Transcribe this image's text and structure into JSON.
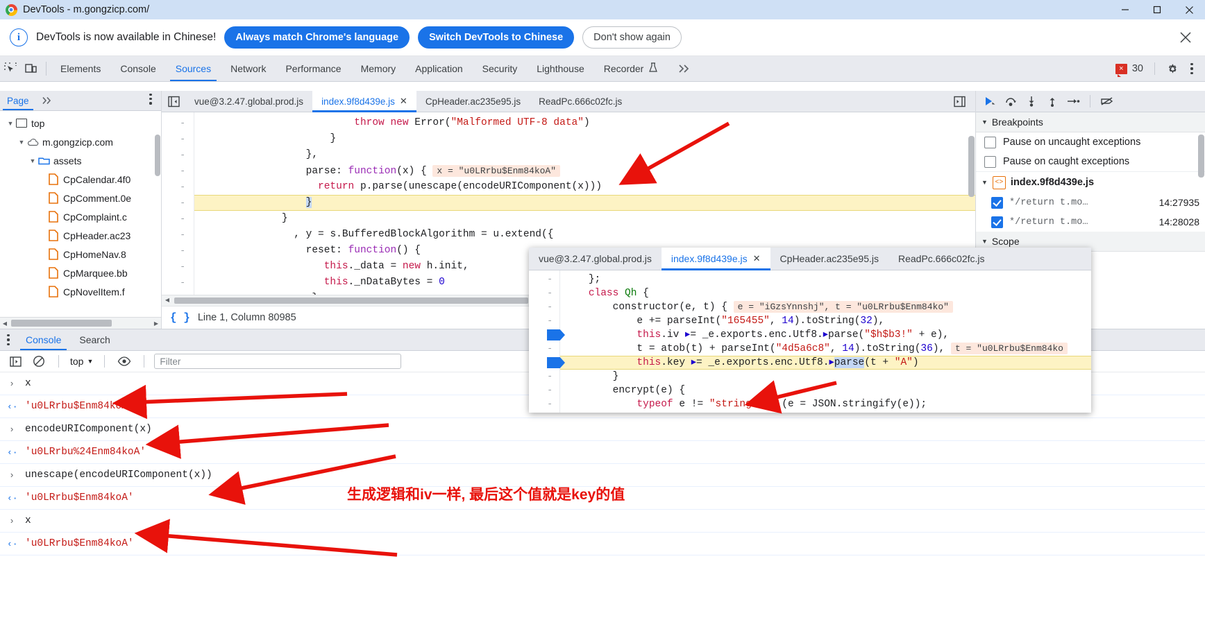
{
  "window": {
    "title": "DevTools - m.gongzicp.com/",
    "logo_icon": "chrome-logo",
    "minimize_icon": "minimize-icon",
    "maximize_icon": "maximize-icon",
    "close_icon": "close-icon"
  },
  "locale_bar": {
    "info_icon": "info-circle-icon",
    "message": "DevTools is now available in Chinese!",
    "always_match_label": "Always match Chrome's language",
    "switch_label": "Switch DevTools to Chinese",
    "dismiss_label": "Don't show again",
    "close_icon": "close-icon",
    "accent_color": "#1a73e8"
  },
  "devtools_tabs": {
    "inspect_icon": "inspect-element-icon",
    "device_icon": "device-toolbar-icon",
    "items": [
      {
        "label": "Elements",
        "active": false
      },
      {
        "label": "Console",
        "active": false
      },
      {
        "label": "Sources",
        "active": true
      },
      {
        "label": "Network",
        "active": false
      },
      {
        "label": "Performance",
        "active": false
      },
      {
        "label": "Memory",
        "active": false
      },
      {
        "label": "Application",
        "active": false
      },
      {
        "label": "Security",
        "active": false
      },
      {
        "label": "Lighthouse",
        "active": false
      },
      {
        "label": "Recorder",
        "active": false
      }
    ],
    "recorder_icon": "flask-icon",
    "overflow_icon": "chevron-double-right-icon",
    "error_badge": {
      "icon": "error-badge-icon",
      "count": "30",
      "color": "#d93025"
    },
    "settings_icon": "gear-icon",
    "menu_icon": "kebab-menu-icon"
  },
  "navigator": {
    "tab_label": "Page",
    "more_icon": "chevron-double-right-icon",
    "menu_icon": "kebab-menu-icon",
    "tree": [
      {
        "label": "top",
        "icon": "frame-icon",
        "depth": 0,
        "caret": "expanded"
      },
      {
        "label": "m.gongzicp.com",
        "icon": "cloud-icon",
        "depth": 1,
        "caret": "expanded"
      },
      {
        "label": "assets",
        "icon": "folder-icon",
        "depth": 2,
        "caret": "expanded"
      },
      {
        "label": "CpCalendar.4f0",
        "icon": "file-icon",
        "depth": 3,
        "caret": "none"
      },
      {
        "label": "CpComment.0e",
        "icon": "file-icon",
        "depth": 3,
        "caret": "none"
      },
      {
        "label": "CpComplaint.c",
        "icon": "file-icon",
        "depth": 3,
        "caret": "none"
      },
      {
        "label": "CpHeader.ac23",
        "icon": "file-icon",
        "depth": 3,
        "caret": "none"
      },
      {
        "label": "CpHomeNav.8",
        "icon": "file-icon",
        "depth": 3,
        "caret": "none"
      },
      {
        "label": "CpMarquee.bb",
        "icon": "file-icon",
        "depth": 3,
        "caret": "none"
      },
      {
        "label": "CpNovelItem.f",
        "icon": "file-icon",
        "depth": 3,
        "caret": "none"
      }
    ],
    "hscroll_left_icon": "triangle-left-icon",
    "hscroll_right_icon": "triangle-right-icon"
  },
  "editor": {
    "panel_toggle_icon": "show-navigator-icon",
    "tabs": [
      {
        "label": "vue@3.2.47.global.prod.js",
        "active": false,
        "closable": false
      },
      {
        "label": "index.9f8d439e.js",
        "active": true,
        "closable": true
      },
      {
        "label": "CpHeader.ac235e95.js",
        "active": false,
        "closable": false
      },
      {
        "label": "ReadPc.666c02fc.js",
        "active": false,
        "closable": false
      }
    ],
    "close_tab_icon": "close-icon",
    "right_panel_icon": "show-debugger-icon",
    "gutter_marks": [
      "-",
      "-",
      "-",
      "-",
      "-",
      "-",
      "-",
      "-",
      "-",
      "-",
      "-",
      "-"
    ],
    "status": {
      "format_icon": "pretty-print-icon",
      "text": "Line 1, Column 80985"
    }
  },
  "code_main": {
    "lines": [
      {
        "indent": 26,
        "highlight": false,
        "tokens": [
          {
            "t": "throw ",
            "c": "kw2"
          },
          {
            "t": "new ",
            "c": "kw2"
          },
          {
            "t": "Error",
            "c": "plain"
          },
          {
            "t": "(",
            "c": "plain"
          },
          {
            "t": "\"Malformed UTF-8 data\"",
            "c": "str"
          },
          {
            "t": ")",
            "c": "plain"
          }
        ]
      },
      {
        "indent": 22,
        "highlight": false,
        "tokens": [
          {
            "t": "}",
            "c": "plain"
          }
        ]
      },
      {
        "indent": 18,
        "highlight": false,
        "tokens": [
          {
            "t": "},",
            "c": "plain"
          }
        ]
      },
      {
        "indent": 18,
        "highlight": false,
        "tokens": [
          {
            "t": "parse",
            "c": "plain"
          },
          {
            "t": ": ",
            "c": "plain"
          },
          {
            "t": "function",
            "c": "kw"
          },
          {
            "t": "(x) { ",
            "c": "plain"
          }
        ],
        "inline_value": "x = \"u0LRrbu$Enm84koA\""
      },
      {
        "indent": 20,
        "highlight": false,
        "tokens": [
          {
            "t": "return ",
            "c": "kw2"
          },
          {
            "t": "p.",
            "c": "plain"
          },
          {
            "t": "parse",
            "c": "plain"
          },
          {
            "t": "(unescape(encodeURIComponent(x)))",
            "c": "plain"
          }
        ]
      },
      {
        "indent": 18,
        "highlight": true,
        "tokens": [
          {
            "t": "}",
            "c": "cursor"
          }
        ]
      },
      {
        "indent": 14,
        "highlight": false,
        "tokens": [
          {
            "t": "}",
            "c": "plain"
          }
        ]
      },
      {
        "indent": 16,
        "highlight": false,
        "tokens": [
          {
            "t": ", y = s.BufferedBlockAlgorithm = u.extend({",
            "c": "plain"
          }
        ]
      },
      {
        "indent": 18,
        "highlight": false,
        "tokens": [
          {
            "t": "reset",
            "c": "plain"
          },
          {
            "t": ": ",
            "c": "plain"
          },
          {
            "t": "function",
            "c": "kw"
          },
          {
            "t": "() {",
            "c": "plain"
          }
        ]
      },
      {
        "indent": 21,
        "highlight": false,
        "tokens": [
          {
            "t": "this",
            "c": "kw2"
          },
          {
            "t": "._data = ",
            "c": "plain"
          },
          {
            "t": "new ",
            "c": "kw2"
          },
          {
            "t": "h.init,",
            "c": "plain"
          }
        ]
      },
      {
        "indent": 21,
        "highlight": false,
        "tokens": [
          {
            "t": "this",
            "c": "kw2"
          },
          {
            "t": "._nDataBytes = ",
            "c": "plain"
          },
          {
            "t": "0",
            "c": "num"
          }
        ]
      },
      {
        "indent": 19,
        "highlight": false,
        "tokens": [
          {
            "t": "},",
            "c": "plain"
          }
        ]
      }
    ]
  },
  "debugger": {
    "toolbar_icons": [
      "resume-icon",
      "step-over-icon",
      "step-into-icon",
      "step-out-icon",
      "step-icon",
      "deactivate-breakpoints-icon"
    ],
    "breakpoints": {
      "section_label": "Breakpoints",
      "caret": "expanded",
      "options": [
        {
          "label": "Pause on uncaught exceptions",
          "checked": false
        },
        {
          "label": "Pause on caught exceptions",
          "checked": false
        }
      ],
      "file": {
        "label": "index.9f8d439e.js",
        "icon": "js-file-icon",
        "caret": "expanded"
      },
      "rows": [
        {
          "label": "*/return t.mo…",
          "location": "14:27935",
          "checked": true
        },
        {
          "label": "*/return t.mo…",
          "location": "14:28028",
          "checked": true
        }
      ]
    },
    "scope": {
      "section_label": "Scope",
      "caret": "expanded"
    }
  },
  "overlay_window": {
    "tabs": [
      {
        "label": "vue@3.2.47.global.prod.js",
        "active": false,
        "closable": false
      },
      {
        "label": "index.9f8d439e.js",
        "active": true,
        "closable": true
      },
      {
        "label": "CpHeader.ac235e95.js",
        "active": false,
        "closable": false
      },
      {
        "label": "ReadPc.666c02fc.js",
        "active": false,
        "closable": false
      }
    ],
    "close_tab_icon": "close-icon",
    "lines": [
      {
        "indent": 4,
        "highlight": false,
        "bp": false,
        "tokens": [
          {
            "t": "};",
            "c": "plain"
          }
        ]
      },
      {
        "indent": 4,
        "highlight": false,
        "bp": false,
        "tokens": [
          {
            "t": "class ",
            "c": "kw2"
          },
          {
            "t": "Qh",
            "c": "tag"
          },
          {
            "t": " {",
            "c": "plain"
          }
        ]
      },
      {
        "indent": 8,
        "highlight": false,
        "bp": false,
        "tokens": [
          {
            "t": "constructor",
            "c": "plain"
          },
          {
            "t": "(e, t) { ",
            "c": "plain"
          }
        ],
        "inline_value": "e = \"iGzsYnnshj\", t = \"u0LRrbu$Enm84ko\""
      },
      {
        "indent": 12,
        "highlight": false,
        "bp": false,
        "tokens": [
          {
            "t": "e += parseInt(",
            "c": "plain"
          },
          {
            "t": "\"165455\"",
            "c": "str"
          },
          {
            "t": ", ",
            "c": "plain"
          },
          {
            "t": "14",
            "c": "num"
          },
          {
            "t": ").toString(",
            "c": "plain"
          },
          {
            "t": "32",
            "c": "num"
          },
          {
            "t": "),",
            "c": "plain"
          }
        ]
      },
      {
        "indent": 12,
        "highlight": false,
        "bp": true,
        "tokens": [
          {
            "t": "this",
            "c": "kw2"
          },
          {
            "t": ".iv ",
            "c": "plain"
          },
          {
            "t": "▸",
            "c": "marker"
          },
          {
            "t": "= _e.exports.enc.Utf8.",
            "c": "plain"
          },
          {
            "t": "▸",
            "c": "marker"
          },
          {
            "t": "parse(",
            "c": "plain"
          },
          {
            "t": "\"$h$b3!\"",
            "c": "str"
          },
          {
            "t": " + e),",
            "c": "plain"
          }
        ]
      },
      {
        "indent": 12,
        "highlight": false,
        "bp": false,
        "tokens": [
          {
            "t": "t = atob(t) + parseInt(",
            "c": "plain"
          },
          {
            "t": "\"4d5a6c8\"",
            "c": "str"
          },
          {
            "t": ", ",
            "c": "plain"
          },
          {
            "t": "14",
            "c": "num"
          },
          {
            "t": ").toString(",
            "c": "plain"
          },
          {
            "t": "36",
            "c": "num"
          },
          {
            "t": "), ",
            "c": "plain"
          }
        ],
        "inline_value": "t = \"u0LRrbu$Enm84ko"
      },
      {
        "indent": 12,
        "highlight": true,
        "bp": true,
        "tokens": [
          {
            "t": "this",
            "c": "kw2"
          },
          {
            "t": ".key ",
            "c": "plain"
          },
          {
            "t": "▸",
            "c": "marker"
          },
          {
            "t": "= _e.exports.enc.Utf8.",
            "c": "plain"
          },
          {
            "t": "▸",
            "c": "marker"
          },
          {
            "t": "parse",
            "c": "cursor"
          },
          {
            "t": "(t + ",
            "c": "plain"
          },
          {
            "t": "\"A\"",
            "c": "str"
          },
          {
            "t": ")",
            "c": "plain"
          }
        ]
      },
      {
        "indent": 8,
        "highlight": false,
        "bp": false,
        "tokens": [
          {
            "t": "}",
            "c": "plain"
          }
        ]
      },
      {
        "indent": 8,
        "highlight": false,
        "bp": false,
        "tokens": [
          {
            "t": "encrypt",
            "c": "plain"
          },
          {
            "t": "(e) {",
            "c": "plain"
          }
        ]
      },
      {
        "indent": 12,
        "highlight": false,
        "bp": false,
        "tokens": [
          {
            "t": "typeof ",
            "c": "kw2"
          },
          {
            "t": "e != ",
            "c": "plain"
          },
          {
            "t": "\"string\"",
            "c": "str"
          },
          {
            "t": " && (e = JSON.stringify(e));",
            "c": "plain"
          }
        ]
      }
    ]
  },
  "drawer": {
    "menu_icon": "kebab-menu-icon",
    "tabs": [
      {
        "label": "Console",
        "active": true
      },
      {
        "label": "Search",
        "active": false
      }
    ],
    "console_toolbar": {
      "sidebar_icon": "console-sidebar-icon",
      "clear_icon": "clear-console-icon",
      "context": "top",
      "context_caret": "chevron-down-icon",
      "eye_icon": "live-expression-icon",
      "filter_placeholder": "Filter"
    },
    "console_rows": [
      {
        "kind": "input",
        "chevron": "›",
        "text": "x"
      },
      {
        "kind": "output",
        "chevron": "‹·",
        "text": "'u0LRrbu$Enm84koA'"
      },
      {
        "kind": "input",
        "chevron": "›",
        "text": "encodeURIComponent(x)"
      },
      {
        "kind": "output",
        "chevron": "‹·",
        "text": "'u0LRrbu%24Enm84koA'"
      },
      {
        "kind": "input",
        "chevron": "›",
        "text": "unescape(encodeURIComponent(x))"
      },
      {
        "kind": "output",
        "chevron": "‹·",
        "text": "'u0LRrbu$Enm84koA'"
      },
      {
        "kind": "input",
        "chevron": "›",
        "text": "x"
      },
      {
        "kind": "output",
        "chevron": "‹·",
        "text": "'u0LRrbu$Enm84koA'"
      }
    ]
  },
  "annotations": {
    "note": "生成逻辑和iv一样, 最后这个值就是key的值",
    "color": "#e8120b"
  }
}
